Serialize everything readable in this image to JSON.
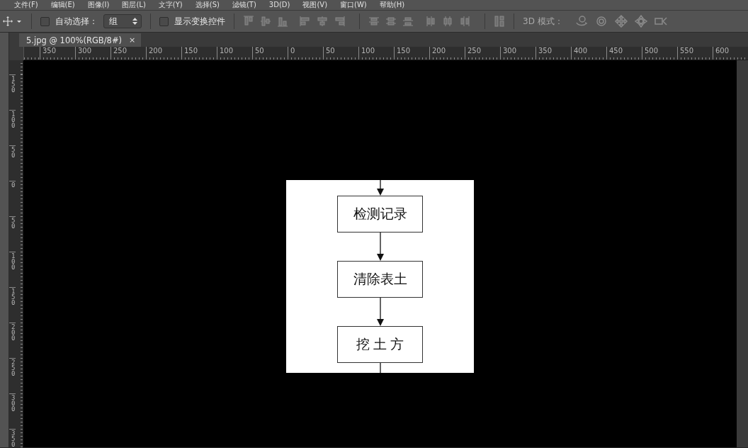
{
  "menu": [
    "文件(F)",
    "编辑(E)",
    "图像(I)",
    "图层(L)",
    "文字(Y)",
    "选择(S)",
    "滤镜(T)",
    "3D(D)",
    "视图(V)",
    "窗口(W)",
    "帮助(H)"
  ],
  "options_bar": {
    "auto_select": {
      "label": "自动选择：",
      "checked": false
    },
    "auto_select_target": "组",
    "show_transform": {
      "label": "显示变换控件",
      "checked": false
    },
    "mode_label": "3D 模式："
  },
  "document_tab": {
    "title": "5.jpg @ 100%(RGB/8#)",
    "close": "×",
    "selected": true
  },
  "rulers": {
    "horizontal": [
      "350",
      "300",
      "250",
      "200",
      "150",
      "100",
      "50",
      "0",
      "50",
      "100",
      "150",
      "200",
      "250",
      "300",
      "350",
      "400",
      "450",
      "500",
      "550",
      "600"
    ],
    "vertical": [
      "150",
      "100",
      "50",
      "0",
      "50",
      "100",
      "150",
      "200",
      "250",
      "300",
      "350"
    ]
  },
  "image": {
    "steps": [
      "检测记录",
      "清除表土",
      "挖 土 方"
    ]
  }
}
